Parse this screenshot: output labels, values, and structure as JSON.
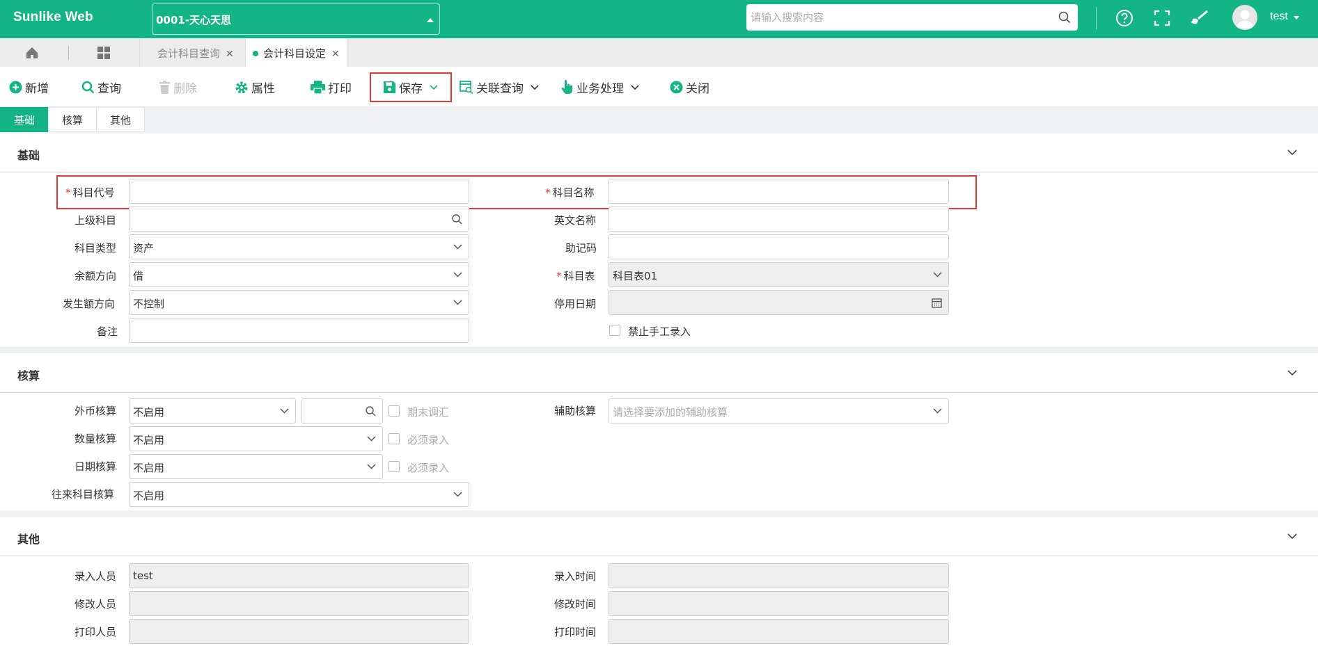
{
  "app": {
    "brand": "Sunlike Web",
    "org_selector": "0001-天心天思",
    "search_placeholder": "请输入搜索内容",
    "user": "test"
  },
  "tabs": [
    {
      "label": "会计科目查询",
      "active": false
    },
    {
      "label": "会计科目设定",
      "active": true
    }
  ],
  "toolbar": {
    "add": "新增",
    "query": "查询",
    "delete": "删除",
    "properties": "属性",
    "print": "打印",
    "save": "保存",
    "related_query": "关联查询",
    "business": "业务处理",
    "close": "关闭"
  },
  "subtabs": [
    "基础",
    "核算",
    "其他"
  ],
  "basic": {
    "title": "基础",
    "account_code_label": "科目代号",
    "account_code_value": "",
    "account_name_label": "科目名称",
    "account_name_value": "",
    "parent_label": "上级科目",
    "parent_value": "",
    "english_name_label": "英文名称",
    "english_name_value": "",
    "type_label": "科目类型",
    "type_value": "资产",
    "mnemonic_label": "助记码",
    "mnemonic_value": "",
    "balance_dir_label": "余额方向",
    "balance_dir_value": "借",
    "chart_label": "科目表",
    "chart_value": "科目表01",
    "occur_dir_label": "发生额方向",
    "occur_dir_value": "不控制",
    "disable_date_label": "停用日期",
    "disable_date_value": "",
    "remark_label": "备注",
    "remark_value": "",
    "no_manual_label": "禁止手工录入"
  },
  "accounting": {
    "title": "核算",
    "foreign_label": "外币核算",
    "foreign_value": "不启用",
    "foreign_currency_value": "",
    "period_end_label": "期末调汇",
    "quantity_label": "数量核算",
    "quantity_value": "不启用",
    "quantity_required_label": "必须录入",
    "date_label": "日期核算",
    "date_value": "不启用",
    "date_required_label": "必须录入",
    "contact_label": "往来科目核算",
    "contact_value": "不启用",
    "aux_label": "辅助核算",
    "aux_placeholder": "请选择要添加的辅助核算"
  },
  "other": {
    "title": "其他",
    "entry_user_label": "录入人员",
    "entry_user_value": "test",
    "entry_time_label": "录入时间",
    "entry_time_value": "",
    "modify_user_label": "修改人员",
    "modify_user_value": "",
    "modify_time_label": "修改时间",
    "modify_time_value": "",
    "print_user_label": "打印人员",
    "print_user_value": "",
    "print_time_label": "打印时间",
    "print_time_value": ""
  },
  "colors": {
    "brand_green": "#14b585",
    "highlight_red": "#e53935"
  }
}
